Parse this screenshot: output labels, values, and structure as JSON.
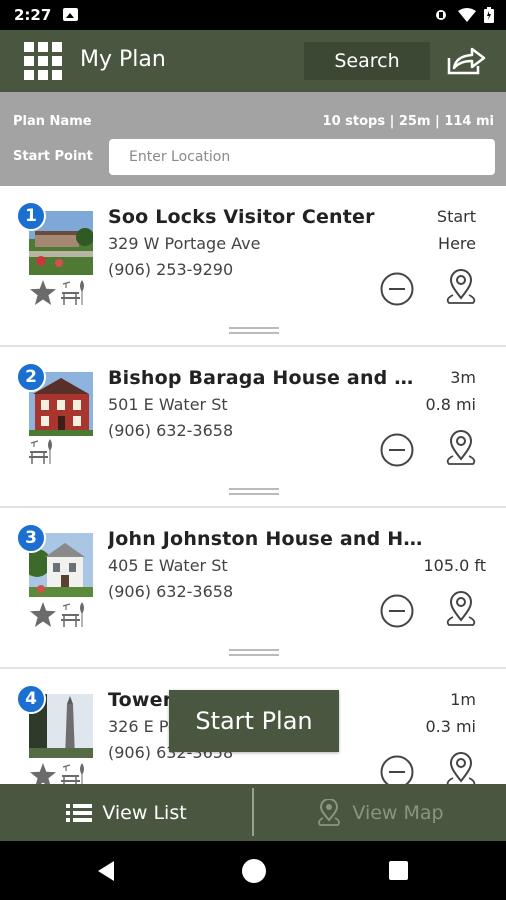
{
  "status_bar": {
    "time": "2:27"
  },
  "header": {
    "title": "My Plan",
    "search_label": "Search"
  },
  "plan": {
    "name_label": "Plan Name",
    "stats": "10 stops | 25m | 114 mi",
    "start_label": "Start Point",
    "start_placeholder": "Enter Location"
  },
  "stops": [
    {
      "number": "1",
      "name": "Soo Locks Visitor Center",
      "address": "329 W Portage Ave",
      "phone": "(906) 253-9290",
      "time": "Start",
      "distance": "Here"
    },
    {
      "number": "2",
      "name": "Bishop Baraga House and Historic",
      "address": "501 E Water St",
      "phone": "(906) 632-3658",
      "time": "3m",
      "distance": "0.8 mi"
    },
    {
      "number": "3",
      "name": "John Johnston House and Historic",
      "address": "405 E Water St",
      "phone": "(906) 632-3658",
      "time": "",
      "distance": "105.0 ft"
    },
    {
      "number": "4",
      "name": "Tower",
      "address": "326 E Portage Ave",
      "phone": "(906) 632-3658",
      "time": "1m",
      "distance": "0.3 mi"
    }
  ],
  "start_plan_label": "Start Plan",
  "bottom_nav": {
    "view_list": "View List",
    "view_map": "View Map"
  },
  "colors": {
    "header": "#4a5740",
    "plan_bar": "#a3a3a3",
    "badge": "#1a6fd0"
  }
}
